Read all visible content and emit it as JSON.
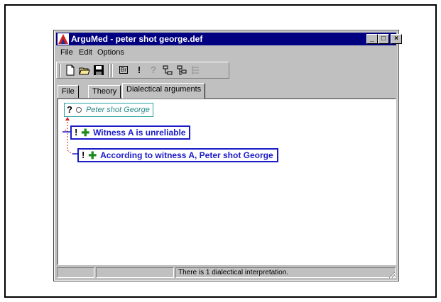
{
  "window": {
    "title": "ArguMed - peter shot george.def",
    "controls": {
      "minimize": "_",
      "maximize": "□",
      "close": "×"
    }
  },
  "menu": {
    "items": [
      {
        "label": "File",
        "icon": ""
      },
      {
        "label": "Edit",
        "icon": ""
      },
      {
        "label": "Options",
        "icon": ""
      }
    ]
  },
  "toolbar": {
    "buttons": [
      {
        "icon": "new-document-icon",
        "glyph": ""
      },
      {
        "icon": "open-folder-icon",
        "glyph": ""
      },
      {
        "icon": "save-disk-icon",
        "glyph": ""
      },
      {
        "icon": "br-icon",
        "glyph": "Br"
      },
      {
        "icon": "exclamation-icon",
        "glyph": "!"
      },
      {
        "icon": "question-icon",
        "glyph": "?"
      },
      {
        "icon": "tree-icon",
        "glyph": ""
      },
      {
        "icon": "tree-alt-icon",
        "glyph": ""
      },
      {
        "icon": "tree-disabled-icon",
        "glyph": ""
      }
    ]
  },
  "tabs": [
    {
      "label": "File",
      "active": false
    },
    {
      "label": "Theory",
      "active": false
    },
    {
      "label": "Dialectical arguments",
      "active": true
    }
  ],
  "graph": {
    "root": {
      "mark": "?",
      "label": "Peter shot George"
    },
    "children": [
      {
        "mark": "!",
        "label": "Witness A is unreliable"
      },
      {
        "mark": "!",
        "label": "According to witness A, Peter shot George"
      }
    ]
  },
  "status": {
    "message": "There is 1 dialectical interpretation."
  },
  "colors": {
    "titlebar": "#000080",
    "node_border_blue": "#1b1bc8",
    "node_border_teal": "#2aa0a0",
    "plus_green": "#1c8a1c",
    "arrow_red": "#d02020"
  }
}
